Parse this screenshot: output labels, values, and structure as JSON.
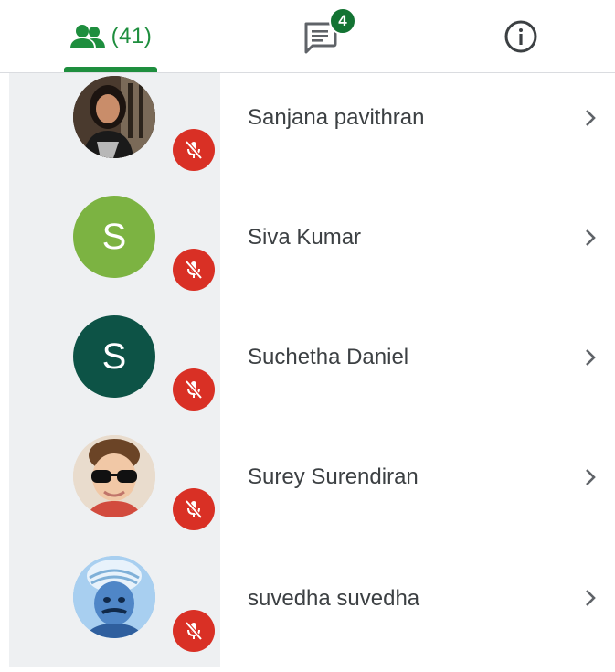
{
  "tabs": {
    "people": {
      "count": "(41)",
      "icon": "people-icon",
      "active": true
    },
    "chat": {
      "badge": "4",
      "icon": "chat-icon"
    },
    "info": {
      "icon": "info-icon"
    }
  },
  "participants": [
    {
      "name": "Sanjana pavithran",
      "avatar": "photo",
      "initial": "",
      "muted": true
    },
    {
      "name": "Siva Kumar",
      "avatar": "initial",
      "initial": "S",
      "color": "#7cb342",
      "muted": true
    },
    {
      "name": "Suchetha Daniel",
      "avatar": "initial",
      "initial": "S",
      "color": "#0d5346",
      "muted": true
    },
    {
      "name": "Surey Surendiran",
      "avatar": "photo",
      "initial": "",
      "muted": true
    },
    {
      "name": "suvedha suvedha",
      "avatar": "photo",
      "initial": "",
      "muted": true
    }
  ],
  "colors": {
    "accent": "#1e8e3e",
    "badge": "#137333",
    "mute": "#d93025",
    "strip": "#eef0f2"
  }
}
